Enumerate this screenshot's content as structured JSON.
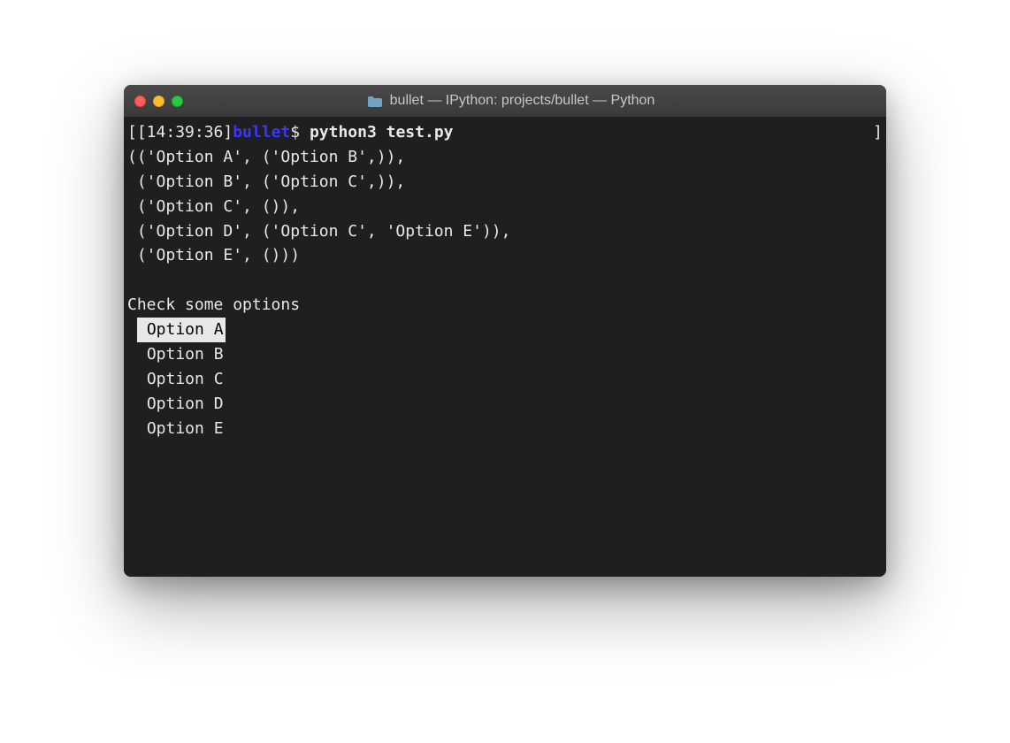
{
  "titlebar": {
    "title": "bullet — IPython: projects/bullet — Python"
  },
  "prompt": {
    "open_bracket": "[",
    "timestamp": "[14:39:36]",
    "dirname": "bullet",
    "dollar": "$",
    "command": "python3 test.py",
    "close_bracket": "]"
  },
  "output_lines": [
    "(('Option A', ('Option B',)),",
    " ('Option B', ('Option C',)),",
    " ('Option C', ()),",
    " ('Option D', ('Option C', 'Option E')),",
    " ('Option E', ()))"
  ],
  "checklist": {
    "heading": "Check some options",
    "options": [
      {
        "label": "Option A",
        "selected": true
      },
      {
        "label": "Option B",
        "selected": false
      },
      {
        "label": "Option C",
        "selected": false
      },
      {
        "label": "Option D",
        "selected": false
      },
      {
        "label": "Option E",
        "selected": false
      }
    ]
  }
}
